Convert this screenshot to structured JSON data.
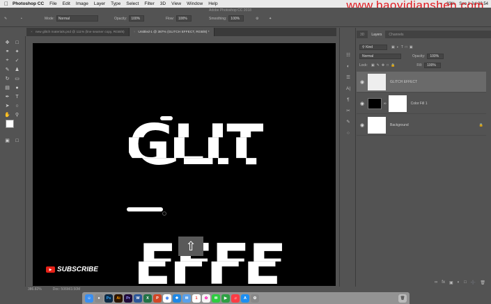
{
  "menubar": {
    "apple": "",
    "items": [
      "Photoshop CC",
      "File",
      "Edit",
      "Image",
      "Layer",
      "Type",
      "Select",
      "Filter",
      "3D",
      "View",
      "Window",
      "Help"
    ],
    "battery": "93%",
    "clock": "Sen 1 Jul 22.54",
    "watermark": "www.baoyidianshen.com"
  },
  "options": {
    "app_title": "Adobe Photoshop CC 2018",
    "mode_label": "Mode:",
    "mode_value": "Normal",
    "opacity_label": "Opacity:",
    "opacity_value": "100%",
    "flow_label": "Flow:",
    "flow_value": "100%",
    "smoothing_label": "Smoothing:",
    "smoothing_value": "100%"
  },
  "tabs": [
    {
      "label": "new glitch materials.psd @ 111% (line seamer copy, RGB/8)",
      "active": false
    },
    {
      "label": "Untitled-1 @ 387% (GLITCH EFFECT, RGB/8) *",
      "active": true
    }
  ],
  "canvas": {
    "word1": "GLIT",
    "word2": "EFFE"
  },
  "status": {
    "zoom": "386.82%",
    "doc": "Doc: 506M/3.50M"
  },
  "panel": {
    "tabs": [
      "3D",
      "Layers",
      "Channels"
    ],
    "active_tab": "Layers",
    "filter": "Kind",
    "blend": "Normal",
    "opacity_label": "Opacity:",
    "opacity": "100%",
    "lock_label": "Lock:",
    "fill_label": "Fill:",
    "fill": "100%",
    "layers": [
      {
        "name": "GLITCH EFFECT",
        "selected": true
      },
      {
        "name": "Color Fill 1",
        "selected": false
      },
      {
        "name": "Background",
        "selected": false
      }
    ]
  },
  "subscribe": {
    "label": "SUBSCRIBE"
  },
  "dock_icons": [
    "finder-icon",
    "launchpad-icon",
    "photoshop-icon",
    "illustrator-icon",
    "premiere-icon",
    "word-icon",
    "excel-icon",
    "powerpoint-icon",
    "chrome-icon",
    "safari-icon",
    "mail-icon",
    "calendar-icon",
    "photos-icon",
    "messages-icon",
    "facetime-icon",
    "music-icon",
    "appstore-icon",
    "settings-icon",
    "trash-icon"
  ]
}
